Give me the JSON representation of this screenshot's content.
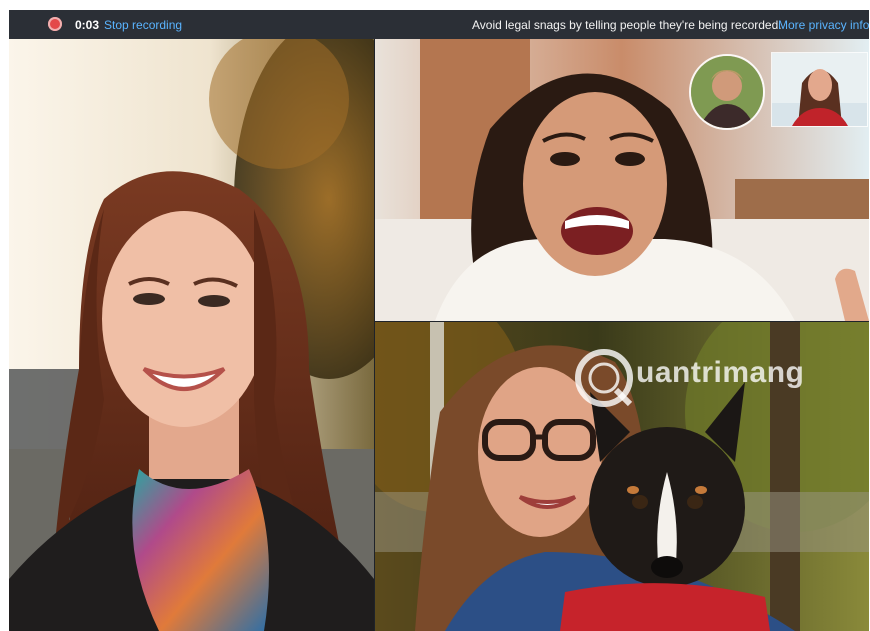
{
  "recording_bar": {
    "elapsed": "0:03",
    "stop_label": "Stop recording",
    "notice": "Avoid legal snags by telling people they're being recorded.",
    "privacy_link": "More privacy info"
  },
  "watermark": {
    "text": "uantrimang"
  },
  "colors": {
    "bar_background": "#2b2f36",
    "link_blue": "#5ab4ff",
    "record_red": "#e34949"
  },
  "icons": [
    "record-icon"
  ]
}
